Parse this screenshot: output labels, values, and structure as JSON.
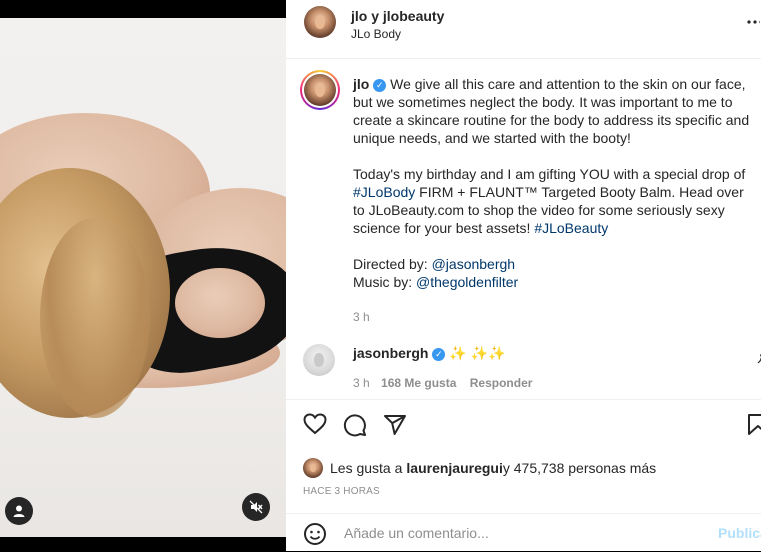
{
  "header": {
    "title": "jlo y jlobeauty",
    "subtitle": "JLo Body",
    "more_icon": "more-horizontal-icon"
  },
  "caption": {
    "username": "jlo",
    "para1": "We give all this care and attention to the skin on our face, but we sometimes neglect the body. It was important to me to create a skincare routine for the body to address its specific and unique needs, and we started with the booty!",
    "para2_a": "Today's my birthday and I am gifting YOU with a special drop of ",
    "hashtag1": "#JLoBody",
    "para2_b": " FIRM + FLAUNT™ Targeted Booty Balm. Head over to JLoBeauty.com to shop the video for some seriously sexy science for your best assets! ",
    "hashtag2": "#JLoBeauty",
    "directed_label": "Directed by: ",
    "directed_by": "@jasonbergh",
    "music_label": "Music by: ",
    "music_by": "@thegoldenfilter",
    "time": "3 h"
  },
  "comment": {
    "username": "jasonbergh",
    "text": "✨ ✨✨",
    "time": "3 h",
    "likes": "168 Me gusta",
    "reply": "Responder"
  },
  "actions": {
    "icons": [
      "heart-icon",
      "comment-icon",
      "share-icon",
      "bookmark-icon"
    ],
    "likes_prefix": "Les gusta a ",
    "likes_user": "laurenjauregui",
    "likes_suffix": " y 475,738 personas más",
    "ago": "HACE 3 HORAS"
  },
  "add_comment": {
    "placeholder": "Añade un comentario...",
    "publish": "Publicar"
  },
  "colors": {
    "verified": "#3897f0",
    "link": "#00376b",
    "muted": "#8e8e8e",
    "publish": "#b2dffc"
  }
}
